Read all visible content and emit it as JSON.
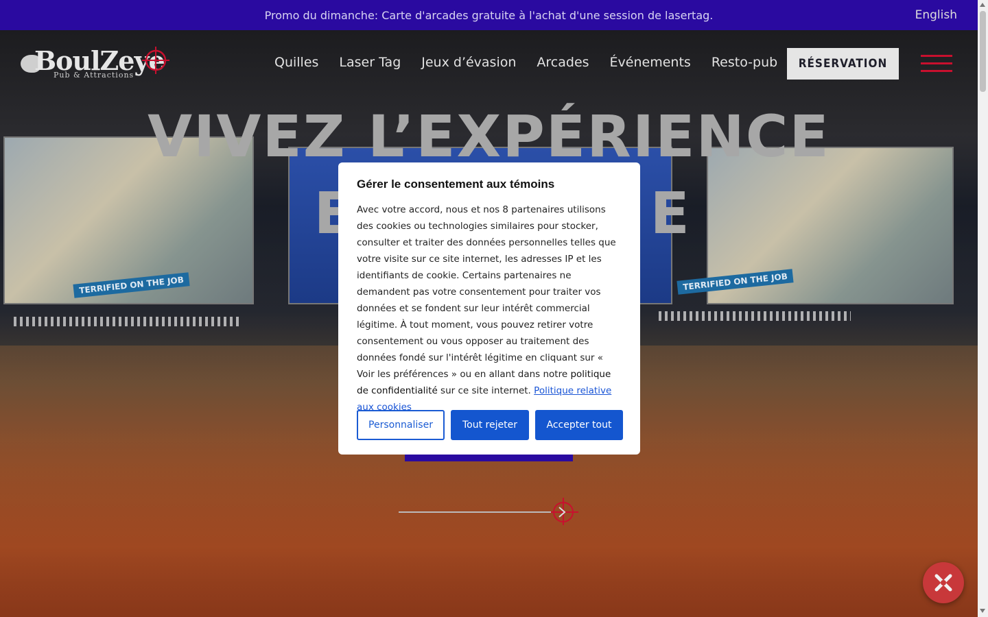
{
  "promo": {
    "text": "Promo du dimanche: Carte d'arcades gratuite à l'achat d'une session de lasertag.",
    "language_link": "English"
  },
  "header": {
    "logo_text": "BoulZeye",
    "logo_subtitle": "Pub & Attractions",
    "nav": [
      "Quilles",
      "Laser Tag",
      "Jeux d’évasion",
      "Arcades",
      "Événements",
      "Resto-pub"
    ],
    "reserve_label": "RÉSERVATION",
    "menu_icon": "hamburger-icon"
  },
  "hero": {
    "headline_line1": "VIVEZ L’EXPÉRIENCE",
    "headline_line2_left": "E",
    "headline_line2_right": "E",
    "screen_tag": "TERRIFIED ON THE JOB"
  },
  "consent": {
    "title": "Gérer le consentement aux témoins",
    "body_before_policy": "Avec votre accord, nous et nos 8 partenaires utilisons des cookies ou technologies similaires pour stocker, consulter et traiter des données personnelles telles que votre visite sur ce site internet, les adresses IP et les identifiants de cookie. Certains partenaires ne demandent pas votre consentement pour traiter vos données et se fondent sur leur intérêt commercial légitime. À tout moment, vous pouvez retirer votre consentement ou vous opposer au traitement des données fondé sur l'intérêt légitime en cliquant sur « Voir les préférences » ou en allant dans notre ",
    "policy_text": "politique de confidentialité",
    "body_after_policy": " sur ce site internet.",
    "cookie_link": "Politique relative aux cookies",
    "buttons": {
      "customize": "Personnaliser",
      "reject": "Tout rejeter",
      "accept": "Accepter tout"
    }
  },
  "colors": {
    "promo_bg": "#2a0aa0",
    "brand_red": "#c8102e",
    "consent_blue": "#1456cf"
  }
}
